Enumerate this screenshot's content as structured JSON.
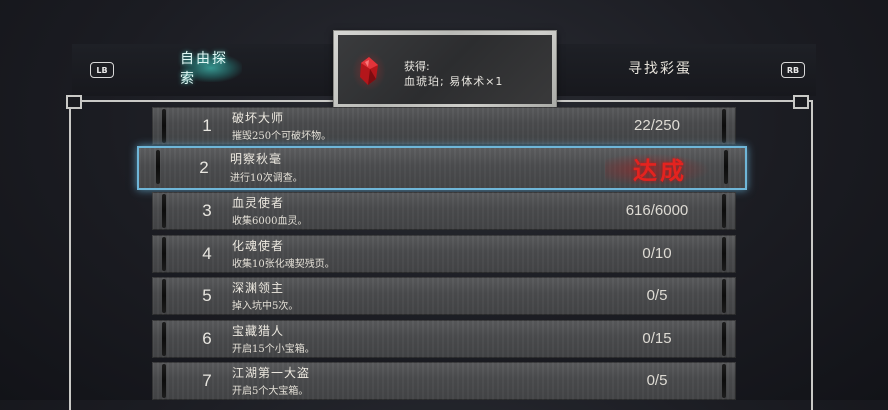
{
  "header": {
    "left_bumper": "LB",
    "right_bumper": "RB",
    "tabs": [
      {
        "label": "自由探索",
        "active": true
      },
      {
        "label": "寻找彩蛋",
        "active": false
      }
    ]
  },
  "reward": {
    "label": "获得:",
    "item": "血琥珀; 易体术×1",
    "icon": "red-crystal-icon"
  },
  "achievements": [
    {
      "num": "1",
      "title": "破坏大师",
      "desc": "摧毁250个可破坏物。",
      "progress": "22/250"
    },
    {
      "num": "2",
      "title": "明察秋毫",
      "desc": "进行10次调查。",
      "status": "达成",
      "completed": true
    },
    {
      "num": "3",
      "title": "血灵使者",
      "desc": "收集6000血灵。",
      "progress": "616/6000"
    },
    {
      "num": "4",
      "title": "化魂使者",
      "desc": "收集10张化魂契残页。",
      "progress": "0/10"
    },
    {
      "num": "5",
      "title": "深渊领主",
      "desc": "掉入坑中5次。",
      "progress": "0/5"
    },
    {
      "num": "6",
      "title": "宝藏猎人",
      "desc": "开启15个小宝箱。",
      "progress": "0/15"
    },
    {
      "num": "7",
      "title": "江湖第一大盗",
      "desc": "开启5个大宝箱。",
      "progress": "0/5"
    }
  ],
  "colors": {
    "accent_teal": "#40beb4",
    "selection_blue": "#6fb6d8",
    "complete_red": "#e4231f"
  }
}
